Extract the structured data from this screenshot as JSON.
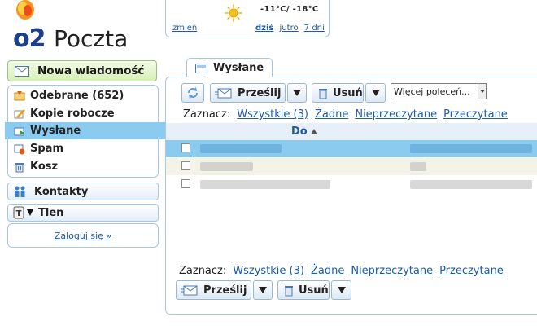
{
  "logo": {
    "brand": "o2",
    "product": "Poczta"
  },
  "weather": {
    "temperature": "-11°C/ -18°C",
    "change_link": "zmień",
    "day_today": "dziś",
    "day_tomorrow": "jutro",
    "day_week": "7 dni"
  },
  "sidebar": {
    "new_message": "Nowa wiadomość",
    "folders": [
      {
        "label": "Odebrane (652)",
        "icon": "inbox-icon"
      },
      {
        "label": "Kopie robocze",
        "icon": "drafts-icon"
      },
      {
        "label": "Wysłane",
        "icon": "sent-icon",
        "active": true
      },
      {
        "label": "Spam",
        "icon": "spam-icon"
      },
      {
        "label": "Kosz",
        "icon": "trash-icon"
      }
    ],
    "contacts": "Kontakty",
    "tlen": "Tlen",
    "login_link": "Zaloguj się »"
  },
  "main": {
    "tab_label": "Wysłane",
    "toolbar": {
      "forward": "Prześlij",
      "delete": "Usuń",
      "more_select": "Więcej poleceń..."
    },
    "mark": {
      "label": "Zaznacz:",
      "all": "Wszystkie (3)",
      "none": "Żadne",
      "unread": "Nieprzeczytane",
      "read": "Przeczytane"
    },
    "column_to": "Do"
  },
  "colors": {
    "accent_blue": "#8ccbf0",
    "border": "#a7c7e2",
    "link": "#1f5aa6",
    "new_message_green": "#d7efb8"
  }
}
